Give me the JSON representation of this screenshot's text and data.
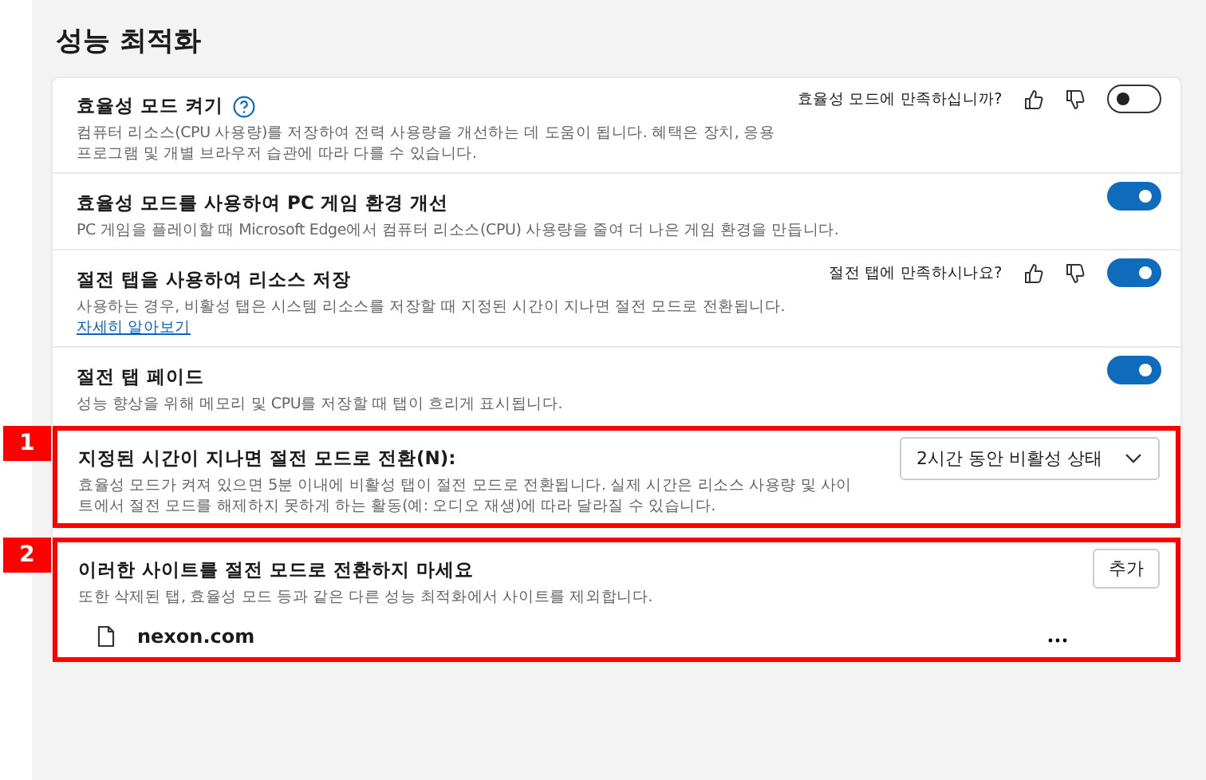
{
  "heading": "성능 최적화",
  "settings": [
    {
      "kind": "toggle",
      "title": "효율성 모드 켜기",
      "help": true,
      "description": "컴퓨터 리소스(CPU 사용량)를 저장하여 전력 사용량을 개선하는 데 도움이 됩니다. 혜택은 장치, 응용 프로그램 및 개별 브라우저 습관에 따라 다를 수 있습니다.",
      "feedback": "효율성 모드에 만족하십니까?",
      "on": false
    },
    {
      "kind": "toggle",
      "title": "효율성 모드를 사용하여 PC 게임 환경 개선",
      "description": "PC 게임을 플레이할 때 Microsoft Edge에서 컴퓨터 리소스(CPU) 사용량을 줄여 더 나은 게임 환경을 만듭니다.",
      "on": true
    },
    {
      "kind": "toggle",
      "title": "절전 탭을 사용하여 리소스 저장",
      "description": "사용하는 경우, 비활성 탭은 시스템 리소스를 저장할 때 지정된 시간이 지나면 절전 모드로 전환됩니다.",
      "link": "자세히 알아보기",
      "feedback": "절전 탭에 만족하시나요?",
      "on": true
    },
    {
      "kind": "toggle",
      "title": "절전 탭 페이드",
      "description": "성능 향상을 위해 메모리 및 CPU를 저장할 때 탭이 흐리게 표시됩니다.",
      "on": true
    },
    {
      "kind": "dropdown",
      "callout": "1",
      "title": "지정된 시간이 지나면 절전 모드로 전환(N):",
      "description": "효율성 모드가 켜져 있으면 5분 이내에 비활성 탭이 절전 모드로 전환됩니다. 실제 시간은 리소스 사용량 및 사이트에서 절전 모드를 해제하지 못하게 하는 활동(예: 오디오 재생)에 따라 달라질 수 있습니다.",
      "value": "2시간 동안 비활성 상태"
    },
    {
      "kind": "sites",
      "callout": "2",
      "title": "이러한 사이트를 절전 모드로 전환하지 마세요",
      "description": "또한 삭제된 탭, 효율성 모드 등과 같은 다른 성능 최적화에서 사이트를 제외합니다.",
      "button": "추가",
      "sites": [
        "nexon.com"
      ]
    }
  ]
}
